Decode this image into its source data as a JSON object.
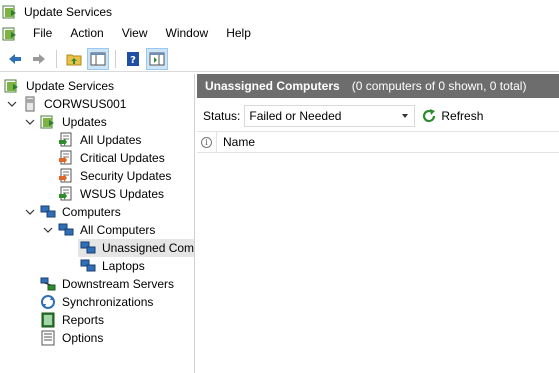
{
  "window": {
    "title": "Update Services"
  },
  "menu": [
    "File",
    "Action",
    "View",
    "Window",
    "Help"
  ],
  "toolbar": {
    "buttons": [
      "back-arrow-icon",
      "forward-arrow-icon",
      "folder-up-icon",
      "show-hide-console-tree-icon",
      "help-icon",
      "action-pane-icon"
    ]
  },
  "tree": {
    "root": "Update Services",
    "server": "CORWSUS001",
    "updates": "Updates",
    "all_updates": "All Updates",
    "critical_updates": "Critical Updates",
    "security_updates": "Security Updates",
    "wsus_updates": "WSUS Updates",
    "computers": "Computers",
    "all_computers": "All Computers",
    "unassigned": "Unassigned Comp",
    "laptops": "Laptops",
    "downstream": "Downstream Servers",
    "synchronizations": "Synchronizations",
    "reports": "Reports",
    "options": "Options"
  },
  "panel": {
    "title": "Unassigned Computers",
    "count": "(0 computers of 0 shown, 0 total)",
    "status_label": "Status:",
    "status_value": "Failed or Needed",
    "refresh_label": "Refresh",
    "info_glyph": "i",
    "name_column": "Name"
  },
  "colors": {
    "header_bg": "#6d6d6d",
    "selection_bg": "#e5e5e5",
    "toolbar_active": "#cce4f7"
  }
}
